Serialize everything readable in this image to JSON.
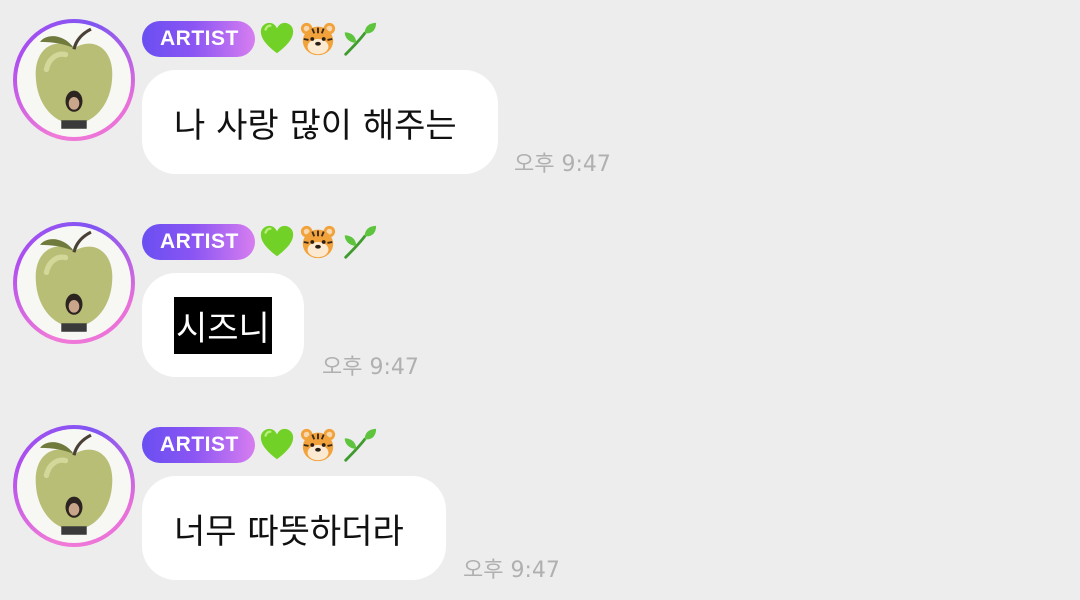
{
  "colors": {
    "background": "#ededed",
    "bubble": "#ffffff",
    "badge_start": "#6a4ff2",
    "badge_end": "#d77ef0",
    "timestamp": "#b0b0b0",
    "highlight": "#000000"
  },
  "messages": [
    {
      "badge": "ARTIST",
      "emojis": [
        "green-heart-icon",
        "tiger-face-icon",
        "seedling-icon"
      ],
      "text": "나 사랑 많이 해주는",
      "time": "오후 9:47",
      "highlighted": false
    },
    {
      "badge": "ARTIST",
      "emojis": [
        "green-heart-icon",
        "tiger-face-icon",
        "seedling-icon"
      ],
      "text": "시즈니",
      "time": "오후 9:47",
      "highlighted": true
    },
    {
      "badge": "ARTIST",
      "emojis": [
        "green-heart-icon",
        "tiger-face-icon",
        "seedling-icon"
      ],
      "text": "너무 따뜻하더라",
      "time": "오후 9:47",
      "highlighted": false
    }
  ]
}
